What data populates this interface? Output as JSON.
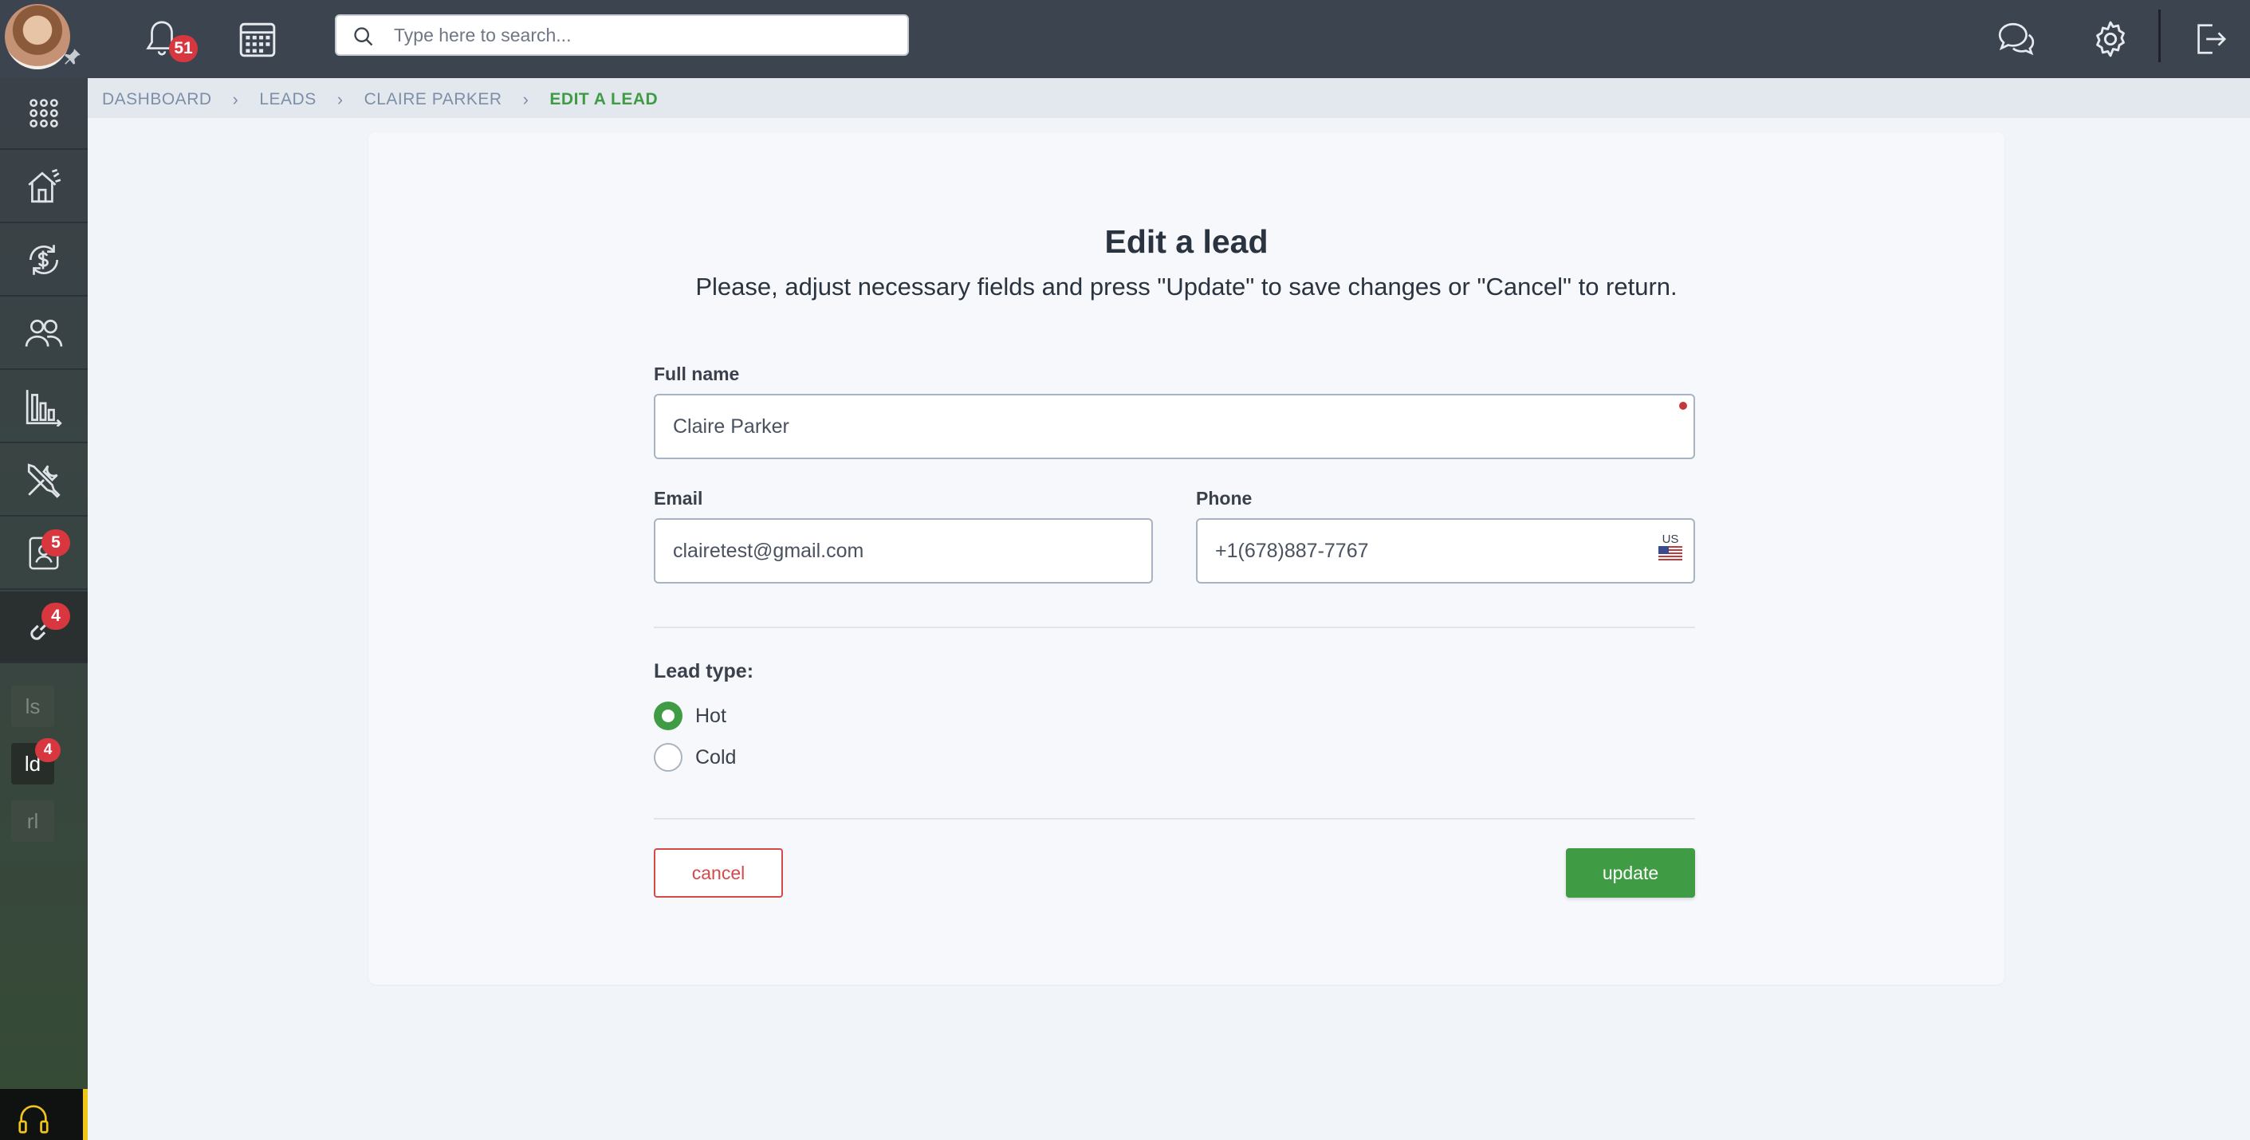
{
  "header": {
    "notifications_count": "51",
    "search_placeholder": "Type here to search...",
    "icons": [
      "bell-icon",
      "calendar-icon",
      "search-icon",
      "chat-icon",
      "gear-icon",
      "logout-icon"
    ]
  },
  "sidebar": {
    "items": [
      {
        "icon": "apps-grid-icon"
      },
      {
        "icon": "house-icon"
      },
      {
        "icon": "dollar-cycle-icon"
      },
      {
        "icon": "users-icon"
      },
      {
        "icon": "bar-chart-icon"
      },
      {
        "icon": "tools-icon"
      },
      {
        "icon": "contact-card-icon",
        "badge": "5"
      },
      {
        "icon": "link-icon",
        "badge": "4"
      }
    ],
    "mini": [
      {
        "label": "ls"
      },
      {
        "label": "ld",
        "badge": "4"
      },
      {
        "label": "rl"
      }
    ],
    "support_icon": "headset-icon"
  },
  "breadcrumb": {
    "items": [
      "DASHBOARD",
      "LEADS",
      "CLAIRE PARKER"
    ],
    "current": "EDIT A LEAD"
  },
  "form": {
    "title": "Edit a lead",
    "subtitle": "Please, adjust necessary fields and press \"Update\" to save changes or \"Cancel\" to return.",
    "full_name_label": "Full name",
    "full_name_value": "Claire Parker",
    "email_label": "Email",
    "email_value": "clairetest@gmail.com",
    "phone_label": "Phone",
    "phone_value": "+1(678)887-7767",
    "phone_country": "US",
    "lead_type_label": "Lead type:",
    "lead_types": [
      {
        "label": "Hot",
        "selected": true
      },
      {
        "label": "Cold",
        "selected": false
      }
    ],
    "cancel_label": "cancel",
    "update_label": "update"
  },
  "colors": {
    "accent": "#3f9c44",
    "danger": "#d44a4a",
    "topbar": "#3c4450"
  }
}
